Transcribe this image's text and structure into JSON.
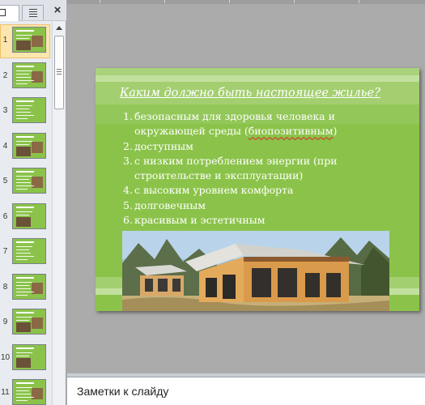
{
  "left_pane": {
    "close_glyph": "×",
    "thumbnails": [
      "1",
      "2",
      "3",
      "4",
      "5",
      "6",
      "7",
      "8",
      "9",
      "10",
      "11"
    ],
    "selected_index": 0
  },
  "slide": {
    "title": "Каким должно быть настоящее жилье?",
    "list": [
      {
        "num": "1.",
        "lines": [
          "безопасным для здоровья человека и",
          "окружающей среды (биопозитивным)"
        ]
      },
      {
        "num": "2.",
        "lines": [
          "доступным"
        ]
      },
      {
        "num": "3.",
        "lines": [
          "с низким потреблением энергии (при",
          "строительстве и эксплуатации)"
        ]
      },
      {
        "num": "4.",
        "lines": [
          "с высоким уровнем комфорта"
        ]
      },
      {
        "num": "5.",
        "lines": [
          "долговечным"
        ]
      },
      {
        "num": "6.",
        "lines": [
          "красивым и эстетичным"
        ]
      }
    ],
    "image_icon": "house-photo"
  },
  "notes": {
    "placeholder": "Заметки к слайду"
  },
  "colors": {
    "slide_bg": "#8bc34a",
    "selection": "#fbe6ae"
  }
}
